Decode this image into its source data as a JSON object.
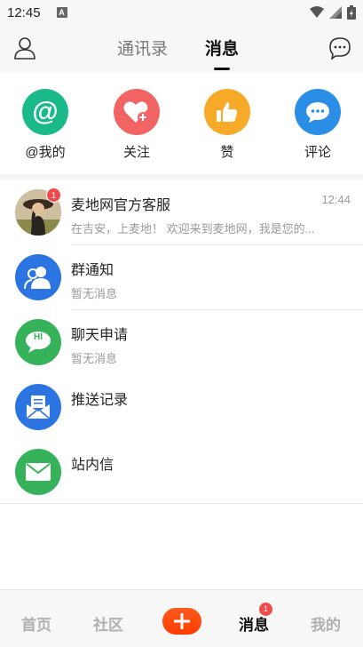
{
  "status_bar": {
    "time": "12:45",
    "notification_letter": "A"
  },
  "header": {
    "tabs": [
      {
        "label": "通讯录",
        "active": false
      },
      {
        "label": "消息",
        "active": true
      }
    ]
  },
  "quick_actions": [
    {
      "label": "@我的",
      "icon": "at-icon",
      "color": "#19b98a",
      "glyph": "@"
    },
    {
      "label": "关注",
      "icon": "heart-plus-icon",
      "color": "#f26464"
    },
    {
      "label": "赞",
      "icon": "thumbs-up-icon",
      "color": "#f7a928"
    },
    {
      "label": "评论",
      "icon": "comment-icon",
      "color": "#2b8ee6"
    }
  ],
  "conversations": [
    {
      "title": "麦地网官方客服",
      "subtitle": "在吉安，上麦地！ 欢迎来到麦地网，我是您的...",
      "time": "12:44",
      "badge": "1",
      "icon": "user-photo-avatar"
    },
    {
      "title": "群通知",
      "subtitle": "暂无消息",
      "icon": "group-icon",
      "color": "#2b74e2"
    },
    {
      "title": "聊天申请",
      "subtitle": "暂无消息",
      "icon": "hi-chat-icon",
      "color": "#36b25a",
      "glyph": "HI"
    },
    {
      "title": "推送记录",
      "subtitle": "",
      "icon": "push-mail-icon",
      "color": "#2b74e2"
    },
    {
      "title": "站内信",
      "subtitle": "",
      "icon": "envelope-icon",
      "color": "#36b25a"
    }
  ],
  "bottom_nav": [
    {
      "label": "首页",
      "active": false
    },
    {
      "label": "社区",
      "active": false
    },
    {
      "label": "消息",
      "active": true,
      "badge": "1"
    },
    {
      "label": "我的",
      "active": false
    }
  ],
  "colors": {
    "accent_orange": "#ff4a10",
    "badge_red": "#f04a4a"
  }
}
